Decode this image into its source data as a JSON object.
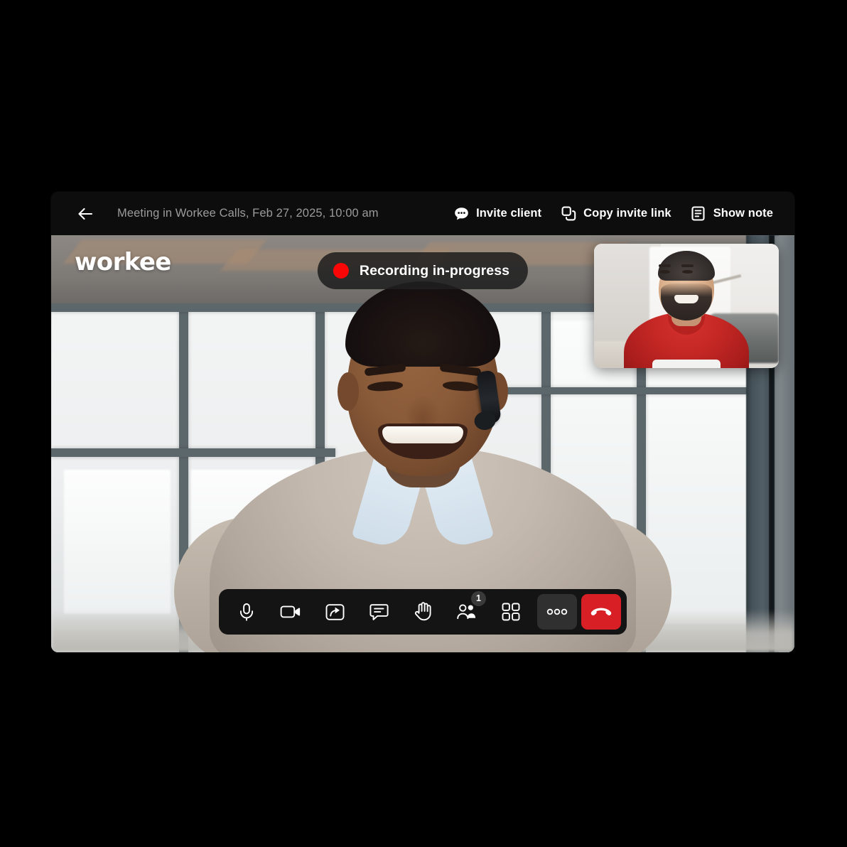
{
  "window": {
    "header": {
      "back_icon": "arrow-left-icon",
      "meeting_title": "Meeting in Workee Calls, Feb 27, 2025, 10:00 am",
      "actions": [
        {
          "label": "Invite client",
          "icon": "chat-bubble-dots-icon"
        },
        {
          "label": "Copy invite link",
          "icon": "copy-icon"
        },
        {
          "label": "Show note",
          "icon": "note-document-icon"
        }
      ]
    },
    "video": {
      "logo_text": "workee",
      "recording_badge": {
        "label": "Recording in-progress",
        "dot_color": "#fb0606",
        "background": "rgba(32,32,32,0.88)"
      },
      "self_view": {
        "label": "self-view-thumbnail"
      },
      "controls": [
        {
          "name": "microphone-button",
          "icon": "microphone-icon",
          "badge": null
        },
        {
          "name": "camera-button",
          "icon": "video-camera-icon",
          "badge": null
        },
        {
          "name": "share-screen-button",
          "icon": "share-screen-icon",
          "badge": null
        },
        {
          "name": "chat-button",
          "icon": "chat-bubble-icon",
          "badge": null
        },
        {
          "name": "raise-hand-button",
          "icon": "raised-hand-icon",
          "badge": null
        },
        {
          "name": "participants-button",
          "icon": "people-icon",
          "badge": "1"
        },
        {
          "name": "layout-button",
          "icon": "grid-layout-icon",
          "badge": null
        },
        {
          "name": "more-options-button",
          "icon": "three-dots-icon",
          "badge": null
        },
        {
          "name": "end-call-button",
          "icon": "phone-hangup-icon",
          "badge": null
        }
      ]
    }
  },
  "colors": {
    "page_background": "#000000",
    "window_background": "#0d0d0d",
    "topbar_background": "#0d0d0d",
    "title_text": "#9b9b9b",
    "action_text": "#ffffff",
    "controlbar_background": "#141414",
    "more_button_background": "#303030",
    "end_call_background": "#d81f26",
    "badge_background": "#3a3a3a",
    "recording_dot": "#fb0606"
  }
}
